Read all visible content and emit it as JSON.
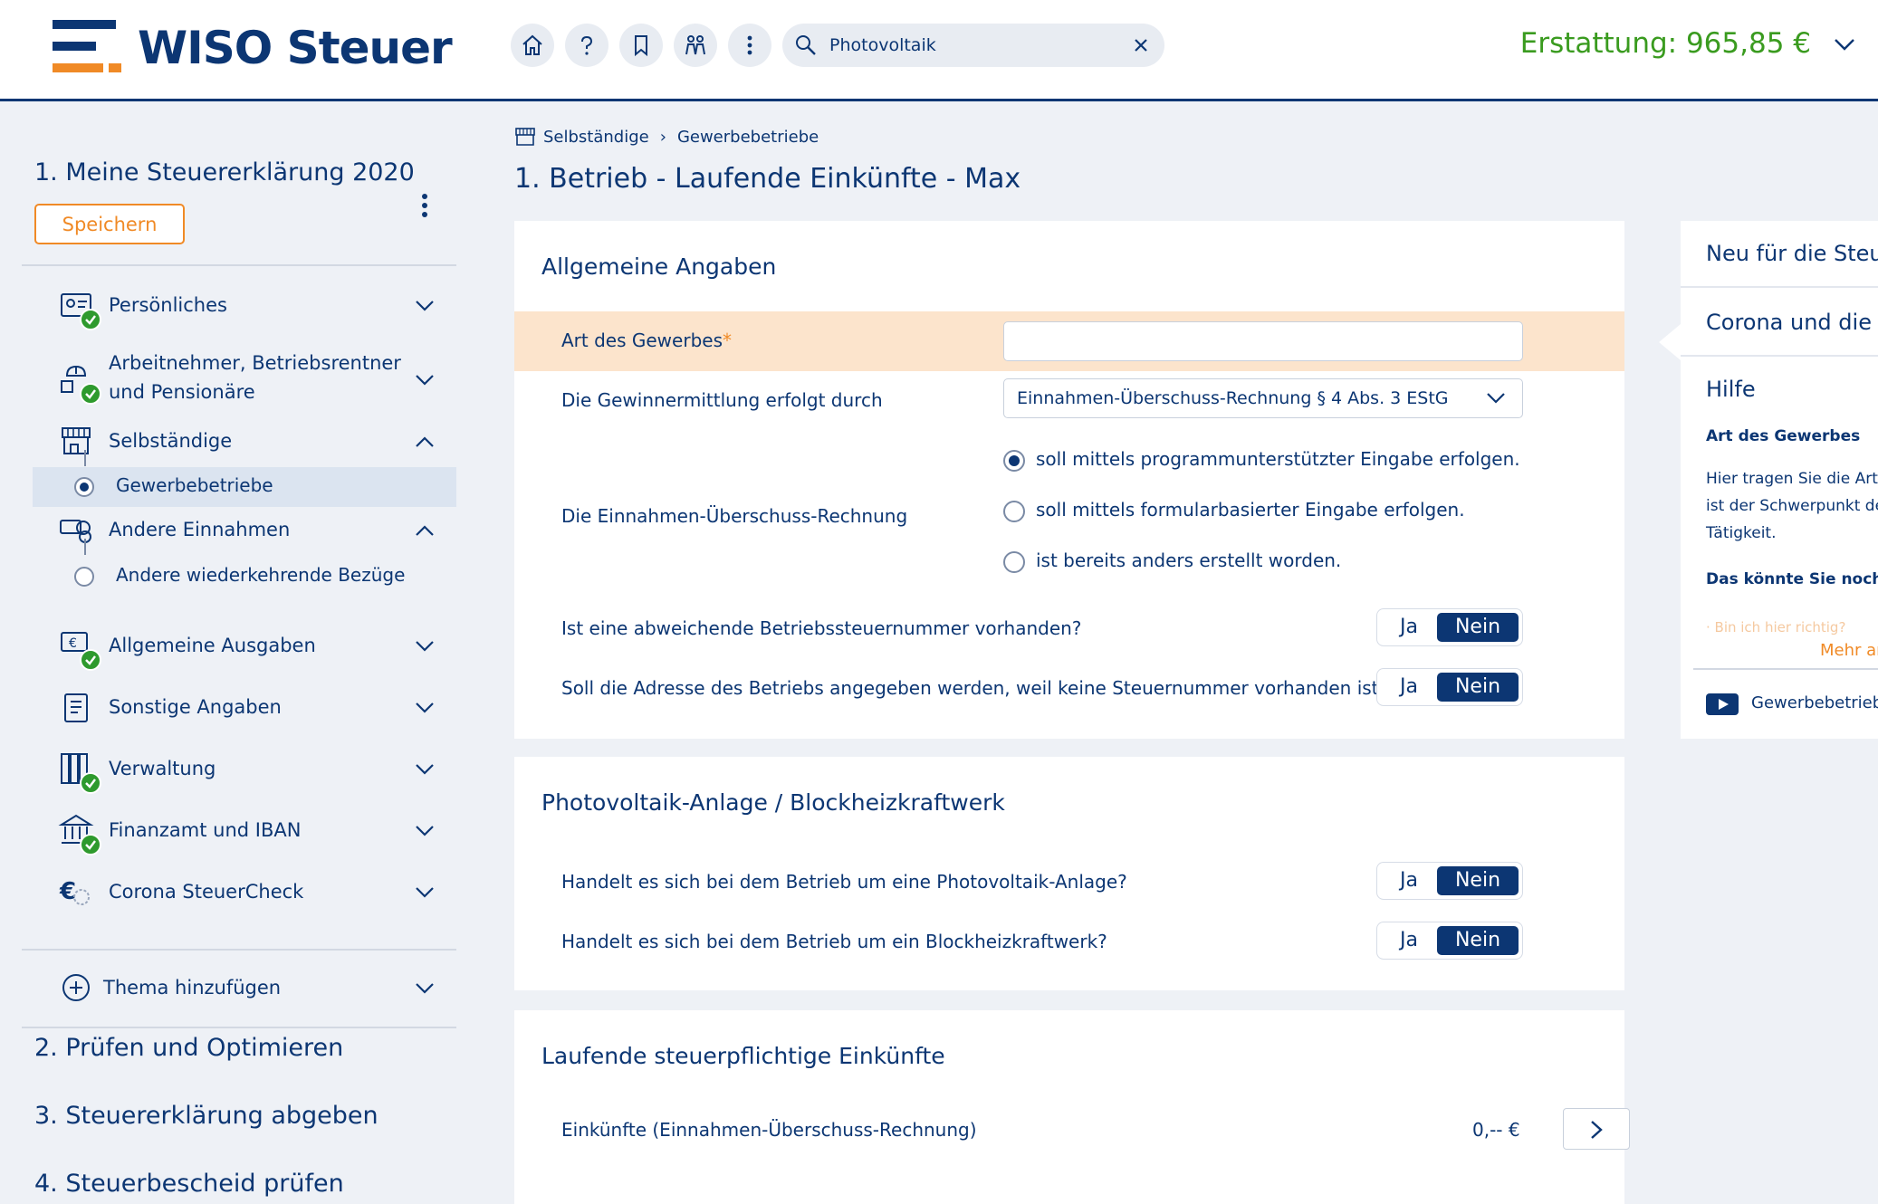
{
  "header": {
    "brand": "WISO Steuer",
    "search_value": "Photovoltaik",
    "refund": "Erstattung: 965,85 €",
    "colors": {
      "brand_blue": "#0c3673",
      "orange": "#f08a26",
      "green": "#3a9b1f"
    }
  },
  "sidebar": {
    "declaration_title": "1. Meine Steuererklärung 2020",
    "save_label": "Speichern",
    "items": [
      {
        "label": "Persönliches",
        "icon": "id-card-icon",
        "done": true,
        "expanded": false
      },
      {
        "label_line1": "Arbeitnehmer, Betriebsrentner",
        "label_line2": "und Pensionäre",
        "icon": "worker-icon",
        "done": true,
        "expanded": false
      },
      {
        "label": "Selbständige",
        "icon": "shop-icon",
        "done": false,
        "expanded": true,
        "children": [
          {
            "label": "Gewerbebetriebe",
            "active": true
          }
        ]
      },
      {
        "label": "Andere Einnahmen",
        "icon": "coins-icon",
        "done": false,
        "expanded": true,
        "children": [
          {
            "label": "Andere wiederkehrende Bezüge",
            "active": false
          }
        ]
      },
      {
        "label": "Allgemeine Ausgaben",
        "icon": "money-icon",
        "done": true,
        "expanded": false
      },
      {
        "label": "Sonstige Angaben",
        "icon": "clipboard-icon",
        "done": false,
        "expanded": false
      },
      {
        "label": "Verwaltung",
        "icon": "folders-icon",
        "done": true,
        "expanded": false
      },
      {
        "label": "Finanzamt und IBAN",
        "icon": "bank-icon",
        "done": true,
        "expanded": false
      },
      {
        "label": "Corona SteuerCheck",
        "icon": "euro-virus-icon",
        "done": false,
        "expanded": false
      }
    ],
    "add_topic": "Thema hinzufügen",
    "steps": [
      "2. Prüfen und Optimieren",
      "3. Steuererklärung abgeben",
      "4. Steuerbescheid prüfen"
    ]
  },
  "main": {
    "breadcrumb": [
      "Selbständige",
      "Gewerbebetriebe"
    ],
    "title": "1. Betrieb - Laufende Einkünfte - Max",
    "section1": {
      "title": "Allgemeine Angaben",
      "art_label": "Art des Gewerbes",
      "art_required": "*",
      "art_value": "",
      "gewinn_label": "Die Gewinnermittlung erfolgt durch",
      "gewinn_value": "Einnahmen-Überschuss-Rechnung § 4 Abs. 3 EStG",
      "eur_label": "Die Einnahmen-Überschuss-Rechnung",
      "eur_options": [
        {
          "label": "soll mittels programmunterstützter Eingabe erfolgen.",
          "selected": true
        },
        {
          "label": "soll mittels formularbasierter Eingabe erfolgen.",
          "selected": false
        },
        {
          "label": "ist bereits anders erstellt worden.",
          "selected": false
        }
      ],
      "q1": "Ist eine abweichende Betriebssteuernummer vorhanden?",
      "q2": "Soll die Adresse des Betriebs angegeben werden, weil keine Steuernummer vorhanden ist?"
    },
    "section2": {
      "title": "Photovoltaik-Anlage / Blockheizkraftwerk",
      "q1": "Handelt es sich bei dem Betrieb um eine Photovoltaik-Anlage?",
      "q2": "Handelt es sich bei dem Betrieb um ein Blockheizkraftwerk?"
    },
    "section3": {
      "title": "Laufende steuerpflichtige Einkünfte",
      "row_label": "Einkünfte (Einnahmen-Überschuss-Rechnung)",
      "row_value": "0,-- €"
    },
    "toggle": {
      "yes": "Ja",
      "no": "Nein",
      "selected": "Nein"
    }
  },
  "right_panel": {
    "items": [
      "Neu für die Steuer",
      "Corona und die S"
    ],
    "help_title": "Hilfe",
    "help_heading": "Art des Gewerbes",
    "help_lines": [
      "Hier tragen Sie die Art d",
      "ist der Schwerpunkt de",
      "Tätigkeit."
    ],
    "more_heading": "Das könnte Sie noch in",
    "faded_link": "· Bin ich hier richtig?",
    "more_link": "Mehr an",
    "video_label": "Gewerbebetrieb"
  }
}
